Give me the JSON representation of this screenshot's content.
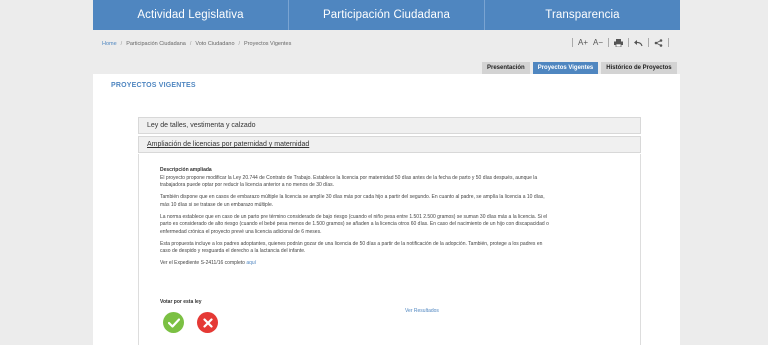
{
  "nav": {
    "items": [
      "Actividad Legislativa",
      "Participación Ciudadana",
      "Transparencia"
    ]
  },
  "breadcrumb": {
    "items": [
      "Home",
      "Participación Ciudadana",
      "Voto Ciudadano",
      "Proyectos Vigentes"
    ],
    "separator": "/"
  },
  "toolbar": {
    "font_increase": "A+",
    "font_decrease": "A−",
    "print_icon": "printer-icon",
    "back_icon": "undo-icon",
    "share_icon": "share-icon"
  },
  "tabs": [
    "Presentación",
    "Proyectos Vigentes",
    "Histórico de Proyectos"
  ],
  "active_tab": "Proyectos Vigentes",
  "panel": {
    "title": "PROYECTOS VIGENTES"
  },
  "accordion": {
    "item1": "Ley de talles, vestimenta y calzado",
    "item2": "Ampliación de licencias por paternidad y maternidad"
  },
  "detail": {
    "heading": "Descripción ampliada",
    "p1": "El proyecto propone modificar la Ley 20.744 de Contrato de Trabajo. Establece la licencia por maternidad 50 días antes de la fecha de parto y 50 días después, aunque la trabajadora puede optar por reducir la licencia anterior a no menos de 30 días.",
    "p2": "También dispone que en casos de embarazo múltiple la licencia se amplíe 30 días más por cada hijo a partir del segundo. En cuanto al padre, se amplía la licencia a 10 días, más 10 días si se tratase de un embarazo múltiple.",
    "p3": "La norma establece que en caso de un parto pre término considerado de bajo riesgo (cuando el niño pesa entre 1.501 2.500 gramos) se suman 30 días más a la licencia. Si el parto es considerado de alto riesgo (cuando el bebé pesa menos de 1.500 gramos) se añaden a la licencia otros 60 días. En caso del nacimiento de un hijo con discapacidad o enfermedad crónica el proyecto prevé una licencia adicional de 6 meses.",
    "p4": "Esta propuesta incluye a los padres adoptantes, quienes podrán gozar de una licencia de 50 días a partir de la notificación de la adopción. También, protege a los padres en caso de despido y resguarda el derecho a la lactancia del infante.",
    "expediente_text": "Ver el Expediente S-2411/16 completo",
    "expediente_link": "aquí"
  },
  "vote": {
    "label": "Votar por esta ley",
    "yes_icon": "check-icon",
    "no_icon": "x-icon",
    "results_link": "Ver Resultados"
  },
  "colors": {
    "brand_blue": "#4f86c0",
    "yes_green": "#7bc043",
    "no_red": "#e53935"
  }
}
